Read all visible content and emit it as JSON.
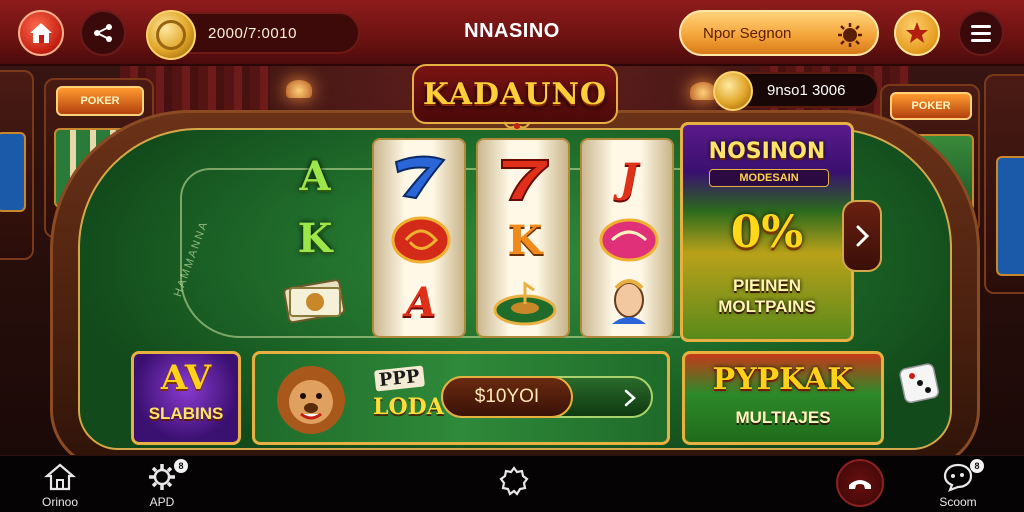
{
  "header": {
    "coin_amount": "2000/7:0010",
    "app_title": "NNASINO",
    "promo_label": "Npor Segnon"
  },
  "game": {
    "logo_text": "KADAUNO",
    "coin_balance": "9nso1 3006",
    "reels": [
      [
        "A",
        "K",
        ""
      ],
      [
        "",
        "",
        "A"
      ],
      [
        "",
        "K",
        ""
      ],
      [
        "J",
        "",
        ""
      ]
    ],
    "felt_text": "HAMMANNA"
  },
  "side_promo": {
    "title": "NOSINON",
    "subtitle": "MODESAIN",
    "percent": "0%",
    "footer_line1": "PIEINEN",
    "footer_line2": "MOLTPAINS"
  },
  "cards": {
    "slots_letter": "AV",
    "slots_label": "SLABINS",
    "lodi_top": "PPP",
    "lodi_label": "LODA",
    "amount": "$10YOI",
    "poker_title": "PYPKAK",
    "poker_sub": "MULTIAJES"
  },
  "bottom_nav": {
    "items": [
      {
        "label": "Orinoo",
        "icon": "home-icon"
      },
      {
        "label": "APD",
        "icon": "gear-icon",
        "badge": "8"
      },
      {
        "label": "",
        "icon": "settings-gear-icon"
      },
      {
        "label": "",
        "icon": "phone-icon"
      },
      {
        "label": "Scoom",
        "icon": "chat-icon",
        "badge": "8"
      }
    ]
  }
}
